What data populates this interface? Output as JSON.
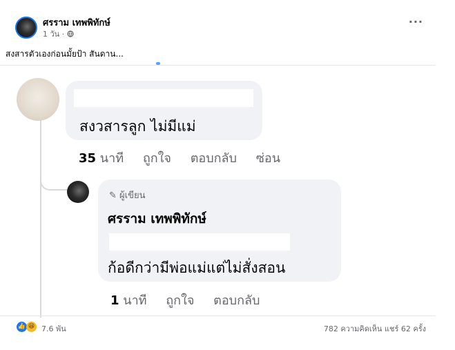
{
  "post": {
    "author": "ศรราม เทพพิทักษ์",
    "meta": "1 วัน · ",
    "text": "สงสารตัวเองก่อนมั้ยป้า สันดาน...",
    "more": "···"
  },
  "comments": [
    {
      "text": "สงวสารลูก ไม่มีแม่",
      "time_num": "35",
      "time_unit": "นาที",
      "like": "ถูกใจ",
      "reply": "ตอบกลับ",
      "hide": "ซ่อน"
    }
  ],
  "reply": {
    "badge": "ผู้เขียน",
    "name": "ศรราม เทพพิทักษ์",
    "text": "ก้อดีกว่ามีพ่อแม่แต่ไม่สั่งสอน",
    "time_num": "1",
    "time_unit": "นาที",
    "like": "ถูกใจ",
    "reply": "ตอบกลับ"
  },
  "footer": {
    "reactions": "7.6 พัน",
    "stats": "782 ความคิดเห็น  แชร์ 62 ครั้ง"
  },
  "colors": {
    "accent": "#1877f2",
    "bubble": "#f0f2f5",
    "muted": "#65676b"
  }
}
